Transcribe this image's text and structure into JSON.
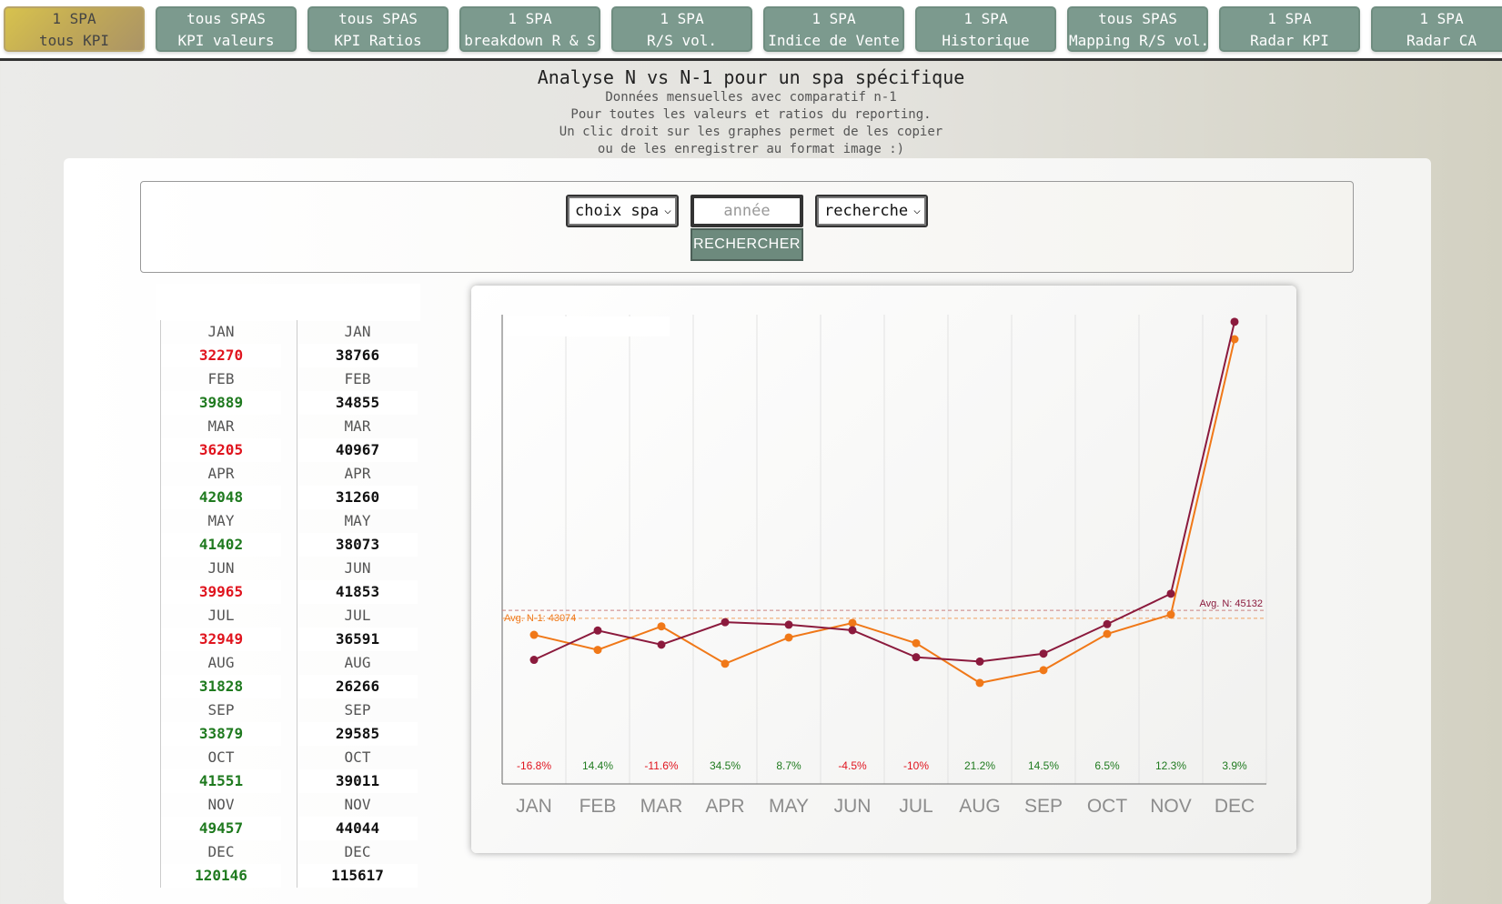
{
  "nav": [
    {
      "line1": "1 SPA",
      "line2": "tous KPI",
      "active": true
    },
    {
      "line1": "tous SPAS",
      "line2": "KPI valeurs"
    },
    {
      "line1": "tous SPAS",
      "line2": "KPI Ratios"
    },
    {
      "line1": "1 SPA",
      "line2": "breakdown R & S"
    },
    {
      "line1": "1 SPA",
      "line2": "R/S vol."
    },
    {
      "line1": "1 SPA",
      "line2": "Indice de Vente"
    },
    {
      "line1": "1 SPA",
      "line2": "Historique"
    },
    {
      "line1": "tous SPAS",
      "line2": "Mapping R/S vol."
    },
    {
      "line1": "1 SPA",
      "line2": "Radar KPI"
    },
    {
      "line1": "1 SPA",
      "line2": "Radar CA"
    }
  ],
  "header": {
    "title": "Analyse N vs N-1 pour un spa spécifique",
    "lines": [
      "Données mensuelles avec comparatif n-1",
      "Pour toutes les valeurs et ratios du reporting.",
      "Un clic droit sur les graphes permet de les copier",
      "ou de les enregistrer au format image :)"
    ]
  },
  "search": {
    "spa_select": "choix spa",
    "year_placeholder": "année",
    "type_select": "recherche",
    "button": "RECHERCHER"
  },
  "table": {
    "months": [
      "JAN",
      "FEB",
      "MAR",
      "APR",
      "MAY",
      "JUN",
      "JUL",
      "AUG",
      "SEP",
      "OCT",
      "NOV",
      "DEC"
    ],
    "n_values": [
      "32270",
      "39889",
      "36205",
      "42048",
      "41402",
      "39965",
      "32949",
      "31828",
      "33879",
      "41551",
      "49457",
      "120146"
    ],
    "n_colors": [
      "#e0141e",
      "#1f7a1f",
      "#e0141e",
      "#1f7a1f",
      "#1f7a1f",
      "#e0141e",
      "#e0141e",
      "#1f7a1f",
      "#1f7a1f",
      "#1f7a1f",
      "#1f7a1f",
      "#1f7a1f"
    ],
    "n1_values": [
      "38766",
      "34855",
      "40967",
      "31260",
      "38073",
      "41853",
      "36591",
      "26266",
      "29585",
      "39011",
      "44044",
      "115617"
    ]
  },
  "chart_data": {
    "type": "line",
    "categories": [
      "JAN",
      "FEB",
      "MAR",
      "APR",
      "MAY",
      "JUN",
      "JUL",
      "AUG",
      "SEP",
      "OCT",
      "NOV",
      "DEC"
    ],
    "series": [
      {
        "values": [
          32270,
          39889,
          36205,
          42048,
          41402,
          39965,
          32949,
          31828,
          33879,
          41551,
          49457,
          120146
        ],
        "color": "#8b1a3d"
      },
      {
        "values": [
          38766,
          34855,
          40967,
          31260,
          38073,
          41853,
          36591,
          26266,
          29585,
          39011,
          44044,
          115617
        ],
        "color": "#f07818"
      }
    ],
    "pct_labels": [
      "-16.8%",
      "14.4%",
      "-11.6%",
      "34.5%",
      "8.7%",
      "-4.5%",
      "-10%",
      "21.2%",
      "14.5%",
      "6.5%",
      "12.3%",
      "3.9%"
    ],
    "pct_colors": [
      "#e0141e",
      "#1f7a1f",
      "#e0141e",
      "#1f7a1f",
      "#1f7a1f",
      "#e0141e",
      "#e0141e",
      "#1f7a1f",
      "#1f7a1f",
      "#1f7a1f",
      "#1f7a1f",
      "#1f7a1f"
    ],
    "avg_n_label": "Avg. N: 45132",
    "avg_n1_label": "Avg. N-1: 43074",
    "avg_n": 45132,
    "avg_n1": 43074,
    "ylim": [
      0,
      122000
    ],
    "grid": "vertical"
  }
}
